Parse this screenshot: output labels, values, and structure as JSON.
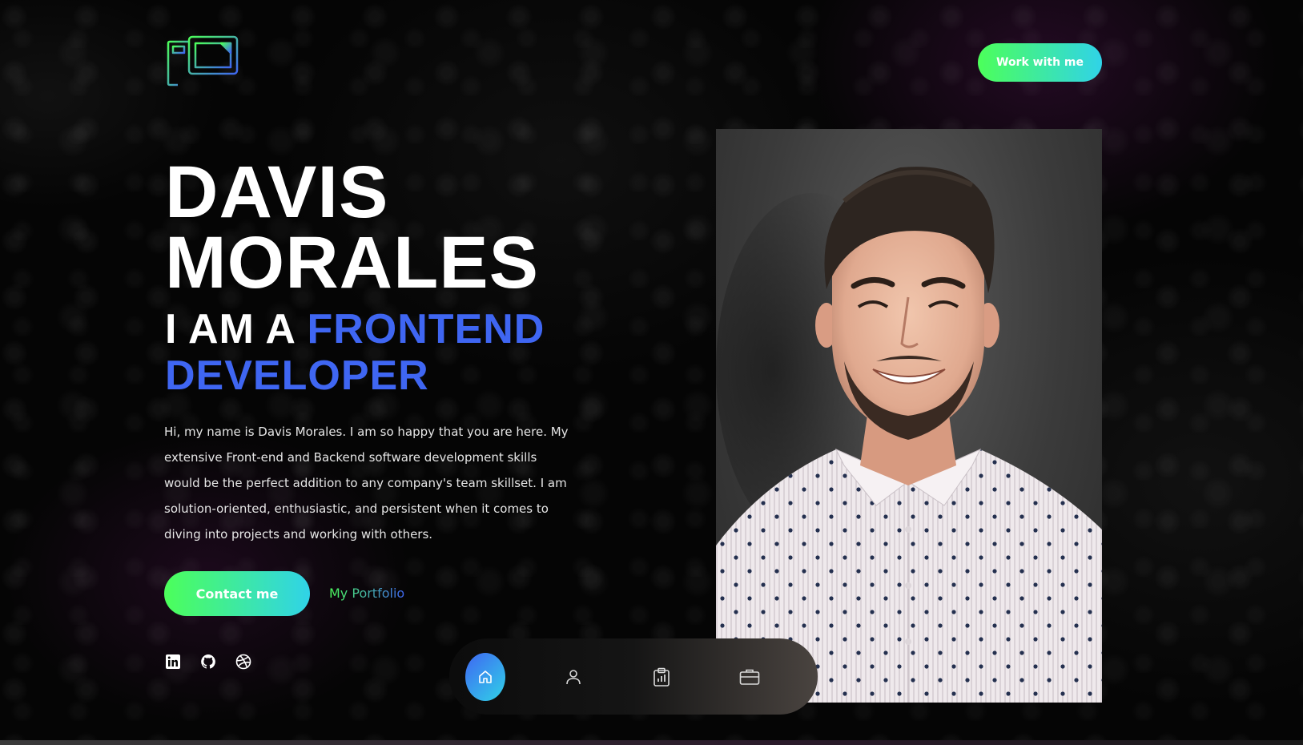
{
  "header": {
    "logo_icon": "computer-monitor-icon",
    "cta_label": "Work with me"
  },
  "hero": {
    "name_line1": "DAVIS",
    "name_line2": "MORALES",
    "role_prefix": "I AM A",
    "role_highlight_line1": "FRONTEND",
    "role_highlight_line2": "DEVELOPER",
    "bio": "Hi, my name is Davis Morales. I am so happy that you are here. My extensive Front-end and Backend software development skills would be the perfect addition to any company's team skillset. I am solution-oriented, enthusiastic, and persistent when it comes to diving into projects and working with others."
  },
  "actions": {
    "contact_label": "Contact me",
    "portfolio_label": "My Portfolio"
  },
  "socials": [
    {
      "icon": "linkedin-icon"
    },
    {
      "icon": "github-icon"
    },
    {
      "icon": "dribbble-icon"
    }
  ],
  "bottom_nav": [
    {
      "icon": "home-icon",
      "active": true
    },
    {
      "icon": "user-icon",
      "active": false
    },
    {
      "icon": "clipboard-chart-icon",
      "active": false
    },
    {
      "icon": "briefcase-icon",
      "active": false
    }
  ],
  "colors": {
    "accent_green": "#4cff5a",
    "accent_cyan": "#30d3e8",
    "accent_blue": "#3f66f2",
    "background": "#050505"
  }
}
